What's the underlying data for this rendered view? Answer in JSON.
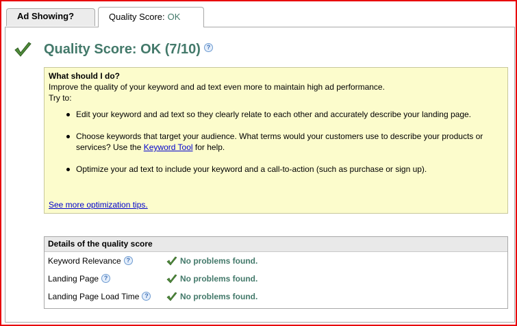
{
  "tabs": [
    {
      "label": "Ad Showing?"
    },
    {
      "label": "Quality Score:",
      "value": "OK"
    }
  ],
  "header": {
    "title": "Quality Score: OK (7/10)",
    "help_glyph": "?"
  },
  "advice": {
    "heading": "What should I do?",
    "intro": "Improve the quality of your keyword and ad text even more to maintain high ad performance.",
    "try_to": "Try to:",
    "items": [
      {
        "text": "Edit your keyword and ad text so they clearly relate to each other and accurately describe your landing page."
      },
      {
        "text_before": "Choose keywords that target your audience. What terms would your customers use to describe your products or services? Use the ",
        "link": "Keyword Tool",
        "text_after": " for help."
      },
      {
        "text": "Optimize your ad text to include your keyword and a call-to-action (such as purchase or sign up)."
      }
    ],
    "see_more": "See more optimization tips."
  },
  "details": {
    "heading": "Details of the quality score",
    "rows": [
      {
        "name": "Keyword Relevance",
        "status": "No problems found."
      },
      {
        "name": "Landing Page",
        "status": "No problems found."
      },
      {
        "name": "Landing Page Load Time",
        "status": "No problems found."
      }
    ]
  },
  "colors": {
    "frame": "#e8000b",
    "accent_green": "#43796a",
    "advice_bg": "#fcfccc",
    "link": "#0000cc"
  },
  "icons": {
    "status": "check-icon",
    "help": "help-icon"
  }
}
